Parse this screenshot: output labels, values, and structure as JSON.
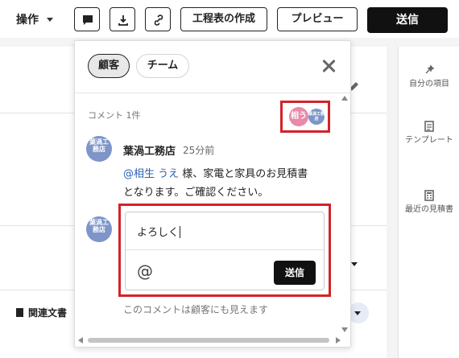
{
  "toolbar": {
    "operations_label": "操作",
    "create_schedule_label": "工程表の作成",
    "preview_label": "プレビュー",
    "send_label": "送信",
    "icons": [
      "comment-icon",
      "download-icon",
      "link-icon"
    ]
  },
  "right_rail": {
    "items": [
      {
        "label": "自分の項目",
        "icon": "sparkle-icon"
      },
      {
        "label": "テンプレート",
        "icon": "template-icon"
      },
      {
        "label": "最近の見積書",
        "icon": "calculator-icon"
      }
    ]
  },
  "page": {
    "related_docs_label": "関連文書"
  },
  "comments_panel": {
    "tabs": [
      {
        "label": "顧客",
        "active": true
      },
      {
        "label": "チーム",
        "active": false
      }
    ],
    "comment_count_label": "コメント 1件",
    "participants": [
      {
        "avatar_text": "相う"
      },
      {
        "avatar_text": "葉渦工務店"
      }
    ],
    "comment": {
      "author": "葉渦工務店",
      "time_ago": "25分前",
      "avatar_text": "葉渦工務店",
      "mention": "@相生 うえ",
      "line1_rest": " 様、家電と家具のお見積書",
      "line2": "となります。ご確認ください。"
    },
    "composer": {
      "value": "よろしく",
      "at_symbol": "@",
      "send_label": "送信",
      "avatar_text": "葉渦工務店"
    },
    "visibility_note": "このコメントは顧客にも見えます"
  },
  "colors": {
    "highlight_red": "#d2232a",
    "mention_blue": "#2c5fb4",
    "primary_button": "#111111"
  }
}
